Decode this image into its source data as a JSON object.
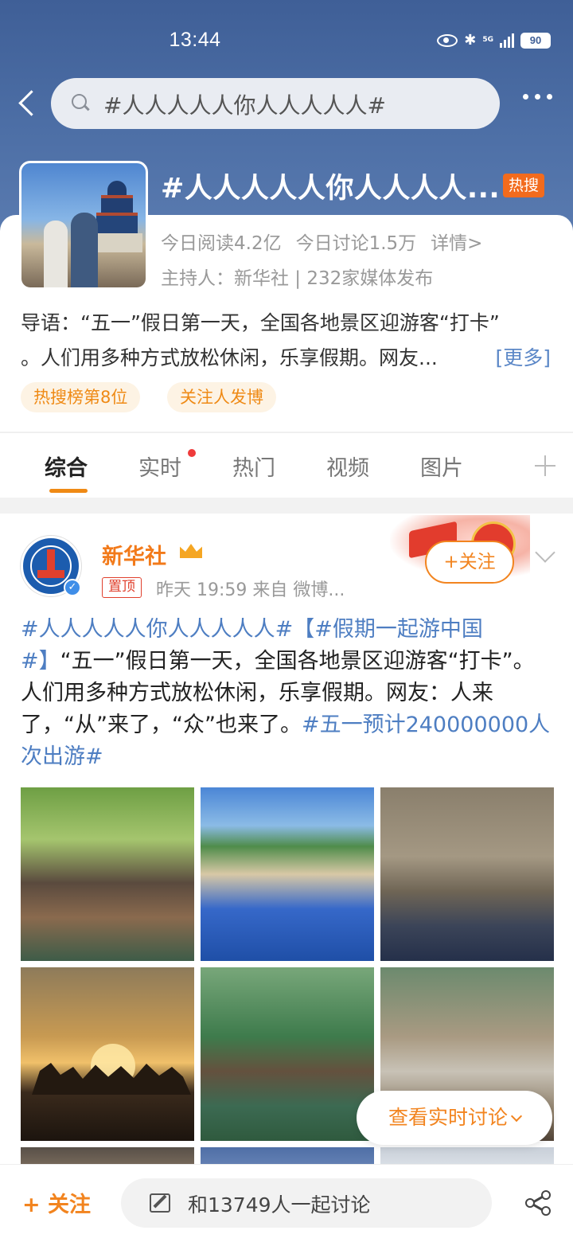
{
  "status_bar": {
    "time": "13:44",
    "network": "5G",
    "battery": "90"
  },
  "header": {
    "search_text": "#人人人人人你人人人人人#"
  },
  "topic": {
    "title": "#人人人人人你人人人人...",
    "hot_badge": "热搜",
    "reads": "今日阅读4.2亿",
    "discussions": "今日讨论1.5万",
    "details": "详情>",
    "host": "主持人：新华社 | 232家媒体发布",
    "intro_line1": "导语：“五一”假日第一天，全国各地景区迎游客“打卡”",
    "intro_line2": "。人们用多种方式放松休闲，乐享假期。网友...",
    "more": "[更多]",
    "chips": [
      "热搜榜第8位",
      "关注人发博"
    ]
  },
  "tabs": [
    "综合",
    "实时",
    "热门",
    "视频",
    "图片"
  ],
  "post": {
    "username": "新华社",
    "pinned": "置顶",
    "meta": "昨天 19:59   来自 微博...",
    "follow": "+关注",
    "text_tag1": "#人人人人人你人人人人人#",
    "text_tag2": "【#假期一起游中国#】",
    "text_body": "“五一”假日第一天，全国各地景区迎游客“打卡”。人们用多种方式放松休闲，乐享假期。网友：人来了，“从”来了，“众”也来了。",
    "text_tag3": "#五一预计240000000人次出游#"
  },
  "floating": {
    "live_discuss": "查看实时讨论"
  },
  "bottom_bar": {
    "follow": "+ 关注",
    "discuss_placeholder": "和13749人一起讨论"
  },
  "colors": {
    "accent": "#f2841f",
    "link": "#4e7ec2",
    "header_bg": "#3f5f97"
  },
  "icons": [
    "back-icon",
    "search-icon",
    "more-icon",
    "verified-icon",
    "crown-icon",
    "chevron-down-icon",
    "edit-icon",
    "share-icon",
    "plus-icon"
  ]
}
